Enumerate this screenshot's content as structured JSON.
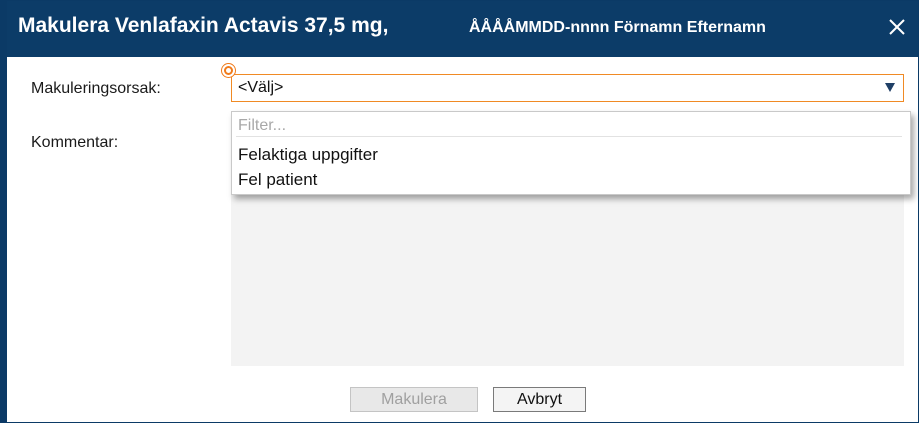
{
  "dialog": {
    "title": "Makulera Venlafaxin Actavis 37,5 mg,",
    "patient": "ÅÅÅÅMMDD-nnnn Förnamn Efternamn"
  },
  "form": {
    "reason_label": "Makuleringsorsak:",
    "reason_selected": "<Välj>",
    "comment_label": "Kommentar:"
  },
  "dropdown": {
    "filter_placeholder": "Filter...",
    "options": [
      "Felaktiga uppgifter",
      "Fel patient"
    ]
  },
  "buttons": {
    "confirm": "Makulera",
    "cancel": "Avbryt"
  },
  "icons": {
    "close": "close-icon",
    "dropdown_arrow": "chevron-down-icon",
    "required": "required-indicator-icon"
  },
  "colors": {
    "titlebar": "#0c3c68",
    "required_accent": "#f07a1a",
    "select_border": "#f08a24",
    "disabled_button_text": "#a0a0a0"
  }
}
